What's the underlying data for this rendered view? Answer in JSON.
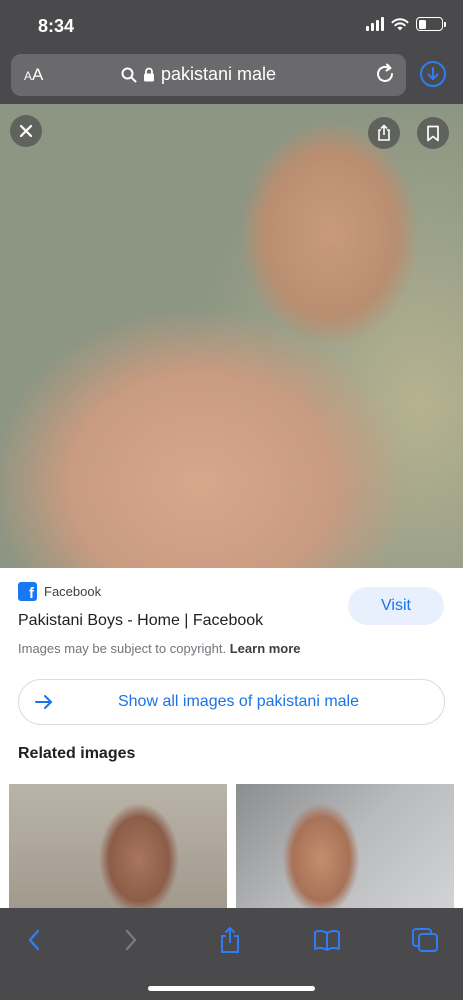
{
  "status_bar": {
    "time": "8:34",
    "battery_level": 0.35
  },
  "url_bar": {
    "text_size_label_small": "A",
    "text_size_label_large": "A",
    "url_text": "pakistani male"
  },
  "colors": {
    "accent": "#1a73e8",
    "ios_blue": "#2f7df6",
    "facebook": "#1877f2"
  },
  "result": {
    "source_name": "Facebook",
    "title": "Pakistani Boys - Home | Facebook",
    "visit_label": "Visit",
    "copyright_text": "Images may be subject to copyright.",
    "learn_more": "Learn more",
    "show_all_label": "Show all images of pakistani male",
    "related_heading": "Related images"
  },
  "icons": {
    "close": "close-icon",
    "share": "share-icon",
    "bookmark": "bookmark-icon",
    "search": "search-icon",
    "lock": "lock-icon",
    "reload": "reload-icon",
    "download": "download-icon",
    "back": "back-icon",
    "forward": "forward-icon",
    "books": "bookmarks-icon",
    "tabs": "tabs-icon"
  }
}
